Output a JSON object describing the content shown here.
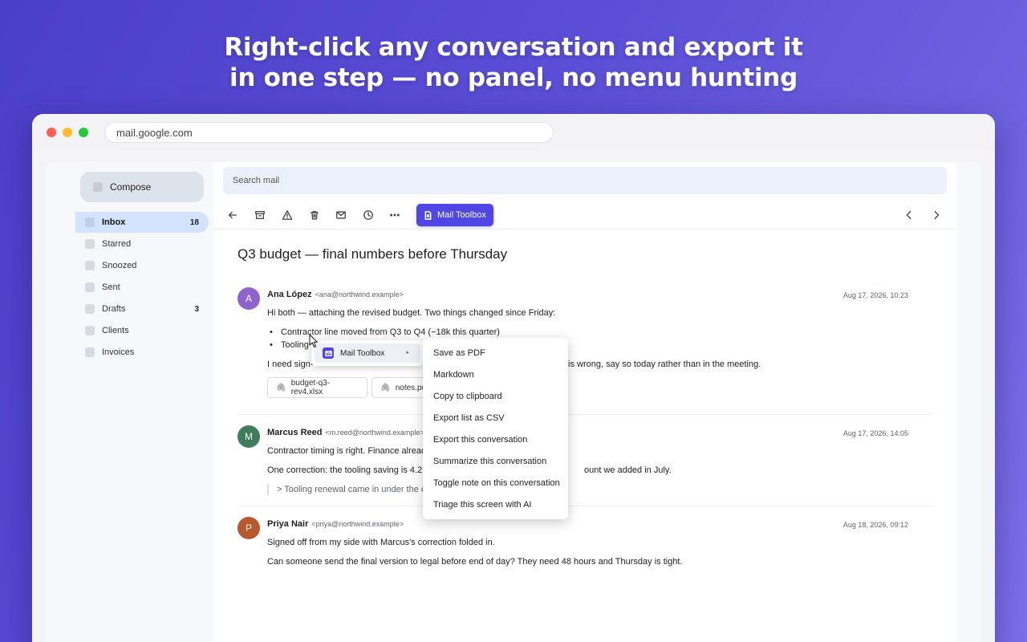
{
  "headline": {
    "line1": "Right-click any conversation and export it",
    "line2": "in one step — no panel, no menu hunting"
  },
  "browser": {
    "url": "mail.google.com"
  },
  "sidebar": {
    "compose_label": "Compose",
    "items": [
      {
        "label": "Inbox",
        "count": "18"
      },
      {
        "label": "Starred",
        "count": ""
      },
      {
        "label": "Snoozed",
        "count": ""
      },
      {
        "label": "Sent",
        "count": ""
      },
      {
        "label": "Drafts",
        "count": "3"
      },
      {
        "label": "Clients",
        "count": ""
      },
      {
        "label": "Invoices",
        "count": ""
      }
    ]
  },
  "search": {
    "placeholder": "Search mail"
  },
  "toolbar": {
    "toolbox_label": "Mail Toolbox"
  },
  "thread": {
    "subject": "Q3 budget — final numbers before Thursday",
    "messages": [
      {
        "initial": "A",
        "name": "Ana López",
        "email": "<ana@northwind.example>",
        "date": "Aug 17, 2026, 10:23",
        "intro": "Hi both — attaching the revised budget. Two things changed since Friday:",
        "bullets": [
          "Contractor line moved from Q3 to Q4 (−18k this quarter)",
          "Tooling"
        ],
        "signoff_start": "I need sign-",
        "signoff_end": "is wrong, say so today rather than in the meeting.",
        "attachments": [
          "budget-q3-rev4.xlsx",
          "notes.pd"
        ]
      },
      {
        "initial": "M",
        "name": "Marcus Reed",
        "email": "<m.reed@northwind.example>",
        "date": "Aug 17, 2026, 14:05",
        "line1": "Contractor timing is right. Finance already",
        "line2_start": "One correction: the tooling saving is 4.2k",
        "line2_end": "ount we added in July.",
        "quote": "> Tooling renewal came in under the e"
      },
      {
        "initial": "P",
        "name": "Priya Nair",
        "email": "<priya@northwind.example>",
        "date": "Aug 18, 2026, 09:12",
        "line1": "Signed off from my side with Marcus's correction folded in.",
        "line2": "Can someone send the final version to legal before end of day? They need 48 hours and Thursday is tight."
      }
    ]
  },
  "context_menu": {
    "parent_label": "Mail Toolbox",
    "items": [
      "Save as PDF",
      "Markdown",
      "Copy to clipboard",
      "Export list as CSV",
      "Export this conversation",
      "Summarize this conversation",
      "Toggle note on this conversation",
      "Triage this screen with AI"
    ]
  },
  "colors": {
    "accent": "#4f46e5",
    "avatar_a": "#8e63ce",
    "avatar_m": "#3f7d5a",
    "avatar_p": "#b65a2e"
  }
}
